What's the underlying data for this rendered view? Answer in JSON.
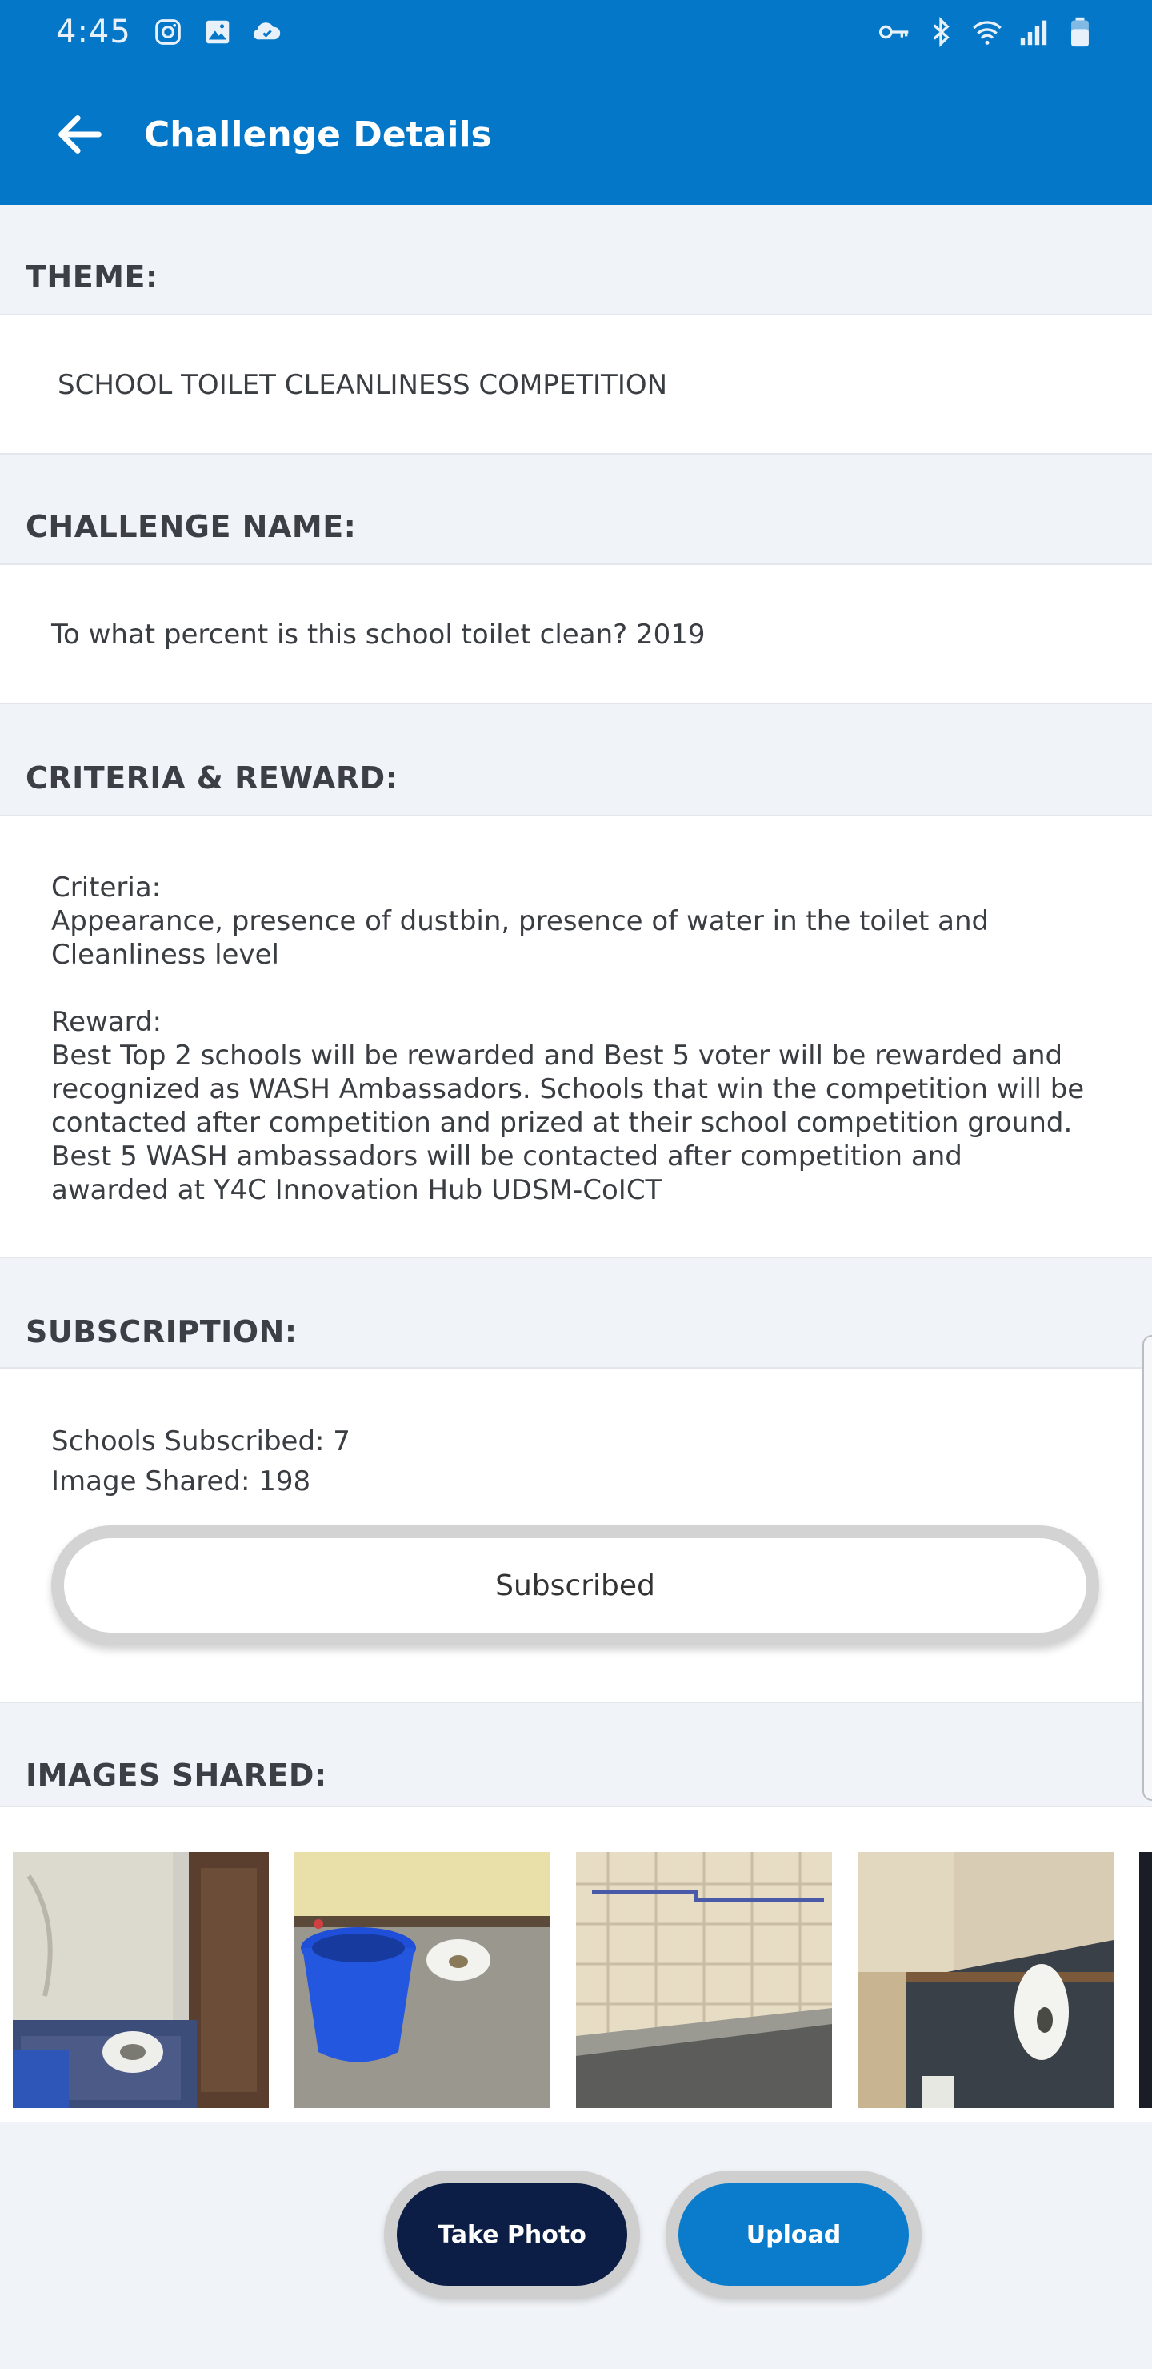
{
  "status_bar": {
    "time": "4:45",
    "left_icons": [
      "instagram-icon",
      "gallery-icon",
      "cloud-sync-icon"
    ],
    "right_icons": [
      "vpn-key-icon",
      "bluetooth-icon",
      "wifi-icon",
      "signal-icon",
      "battery-icon"
    ]
  },
  "app_bar": {
    "title": "Challenge Details",
    "back_icon": "arrow-left-icon"
  },
  "theme": {
    "label": "THEME:",
    "value": "SCHOOL TOILET CLEANLINESS COMPETITION"
  },
  "challenge_name": {
    "label": "CHALLENGE NAME:",
    "value": "To what percent is this school toilet clean? 2019"
  },
  "criteria_reward": {
    "label": "CRITERIA & REWARD:",
    "criteria_heading": "Criteria:",
    "criteria_text": "Appearance, presence of dustbin, presence of water in the toilet and Cleanliness level",
    "reward_heading": "Reward:",
    "reward_text": "Best Top 2 schools will be rewarded and Best 5 voter will be rewarded and recognized as WASH Ambassadors. Schools that win the competition will be contacted after competition and prized at their school competition ground.  Best 5 WASH ambassadors will be contacted after competition and awarded at Y4C Innovation Hub UDSM-CoICT"
  },
  "subscription": {
    "label": "SUBSCRIPTION:",
    "schools_subscribed": "Schools Subscribed: 7",
    "image_shared": "Image Shared: 198",
    "button_label": "Subscribed"
  },
  "images_shared": {
    "label": "IMAGES SHARED:"
  },
  "actions": {
    "take_photo": "Take Photo",
    "upload": "Upload"
  },
  "colors": {
    "app_bar": "#0477c8",
    "take_photo_button": "#0c1e45",
    "upload_button": "#0a7ccb",
    "background": "#f0f3f7"
  }
}
